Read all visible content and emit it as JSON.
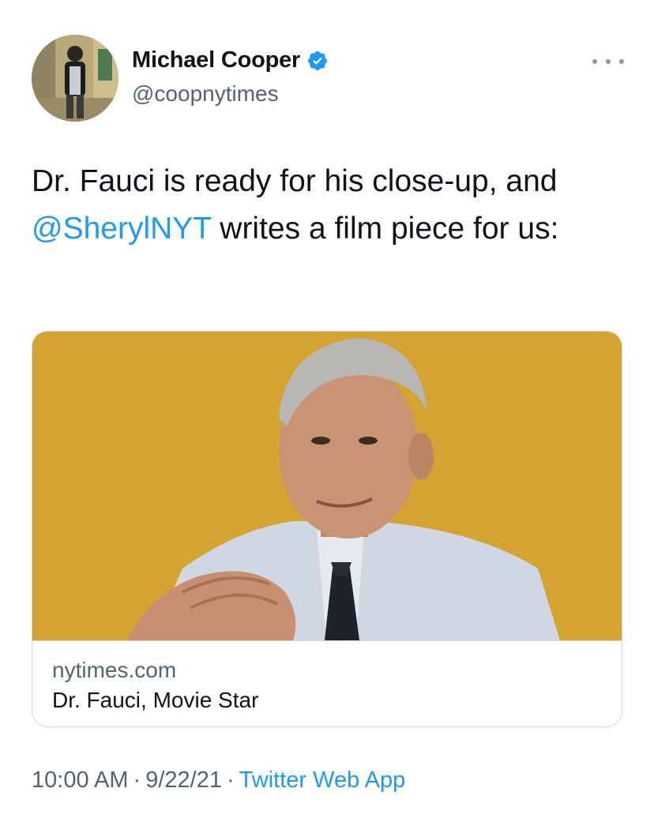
{
  "author": {
    "name": "Michael Cooper",
    "handle": "@coopnytimes",
    "verified": true
  },
  "tweet": {
    "text_before": "Dr. Fauci is ready for his close-up, and ",
    "mention": "@SherylNYT",
    "text_after": " writes a film piece for us:"
  },
  "card": {
    "domain": "nytimes.com",
    "title": "Dr. Fauci, Movie Star"
  },
  "meta": {
    "time": "10:00 AM",
    "separator": "·",
    "date": "9/22/21",
    "source": "Twitter Web App"
  },
  "colors": {
    "link": "#1d9bf0",
    "secondary_text": "#536471",
    "card_background": "#d5a331"
  },
  "icons": {
    "verified": "verified-badge-icon",
    "more": "more-options-icon"
  }
}
